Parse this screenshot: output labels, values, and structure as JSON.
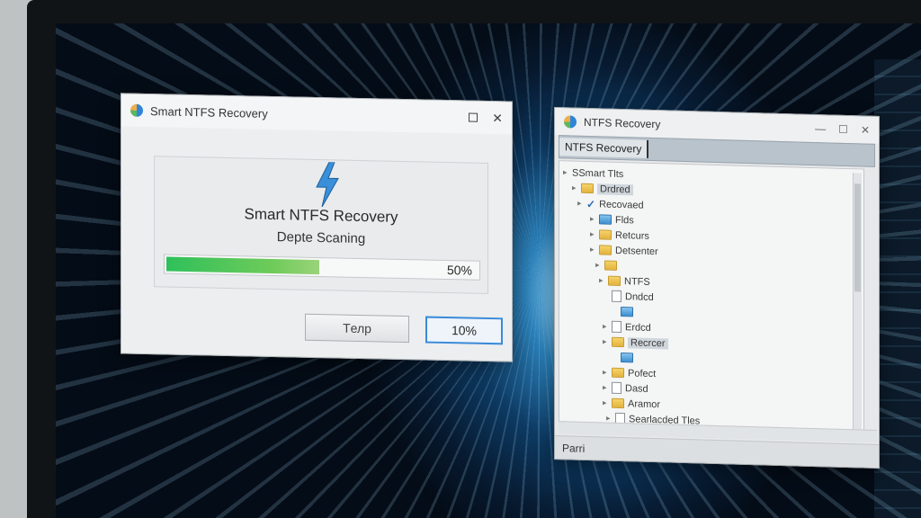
{
  "dialog": {
    "title": "Smart NTFS Recovery",
    "app_name": "Smart NTFS Recovery",
    "status": "Depte Scaning",
    "progress": {
      "value": 0.5,
      "label": "50%"
    },
    "help_label": "Tелp",
    "confirm_label": "10%",
    "maximize_icon": "maximize-icon",
    "close_glyph": "✕"
  },
  "explorer": {
    "title": "NTFS Recovery",
    "bar_label": "NTFS Recovery",
    "status_bar": "Parri",
    "tree": [
      {
        "label": "SSmart Tlts",
        "icon": "none"
      },
      {
        "label": "Drdred",
        "icon": "folder"
      },
      {
        "label": "Recovaed",
        "icon": "check"
      },
      {
        "label": "Flds",
        "icon": "folder-blue"
      },
      {
        "label": "Retcurs",
        "icon": "folder"
      },
      {
        "label": "Detsenter",
        "icon": "folder"
      },
      {
        "label": "",
        "icon": "folder"
      },
      {
        "label": "NTFS",
        "icon": "folder"
      },
      {
        "label": "Dndcd",
        "icon": "file"
      },
      {
        "label": "",
        "icon": "folder-blue"
      },
      {
        "label": "Erdcd",
        "icon": "file"
      },
      {
        "label": "Recrcer",
        "icon": "folder"
      },
      {
        "label": "",
        "icon": "folder-blue"
      },
      {
        "label": "Pofect",
        "icon": "folder"
      },
      {
        "label": "Dasd",
        "icon": "file"
      },
      {
        "label": "Aramor",
        "icon": "folder"
      },
      {
        "label": "Searlacded Tles",
        "icon": "file"
      }
    ]
  },
  "colors": {
    "progress_green": "#2fc05a",
    "accent_blue": "#3b8ad9"
  }
}
